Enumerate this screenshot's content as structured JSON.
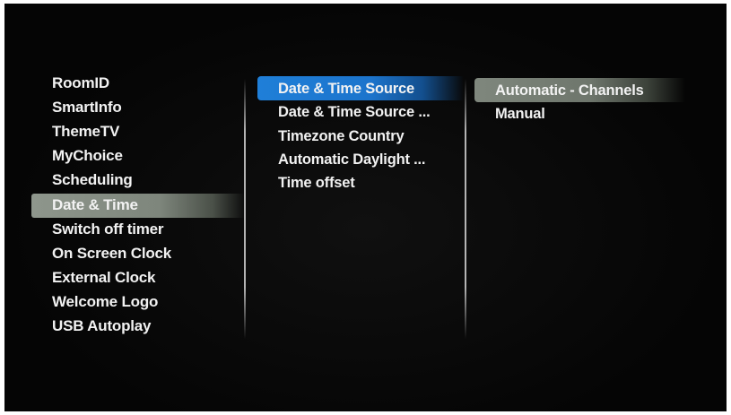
{
  "menu": {
    "items": [
      {
        "label": "RoomID"
      },
      {
        "label": "SmartInfo"
      },
      {
        "label": "ThemeTV"
      },
      {
        "label": "MyChoice"
      },
      {
        "label": "Scheduling"
      },
      {
        "label": "Date & Time"
      },
      {
        "label": "Switch off timer"
      },
      {
        "label": "On Screen Clock"
      },
      {
        "label": "External Clock"
      },
      {
        "label": "Welcome Logo"
      },
      {
        "label": "USB Autoplay"
      }
    ],
    "selected": "Date & Time"
  },
  "submenu": {
    "items": [
      {
        "label": "Date & Time Source"
      },
      {
        "label": "Date & Time Source ..."
      },
      {
        "label": "Timezone Country"
      },
      {
        "label": "Automatic Daylight ..."
      },
      {
        "label": "Time offset"
      }
    ],
    "focused": "Date & Time Source"
  },
  "options": {
    "items": [
      {
        "label": "Automatic - Channels"
      },
      {
        "label": "Manual"
      }
    ],
    "selected": "Automatic - Channels"
  },
  "colors": {
    "background": "#060606",
    "focus_highlight": "#1f7fd8",
    "selection_highlight": "#8e968c",
    "text": "#f2f2f2"
  }
}
